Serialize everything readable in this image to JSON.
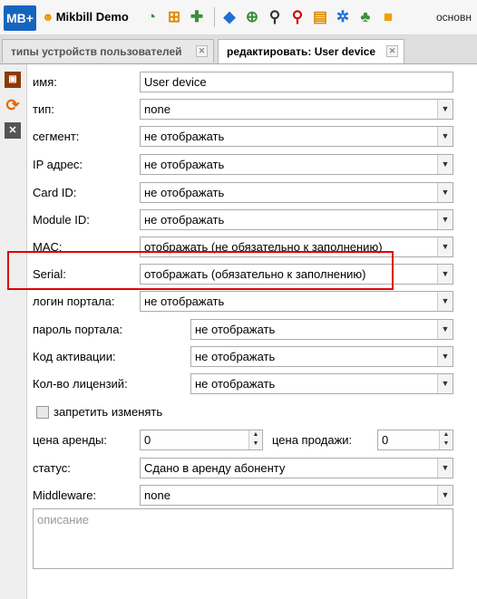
{
  "app": {
    "logo": "MB+",
    "name": "Mikbill Demo",
    "right_text": "основн"
  },
  "toolbar_icons": [
    {
      "name": "dashboard-icon",
      "glyph": "◔",
      "color": "#3a8f3a"
    },
    {
      "name": "calendar-add-icon",
      "glyph": "⊞",
      "color": "#e08a00"
    },
    {
      "name": "add-user-icon",
      "glyph": "✚",
      "color": "#3a8f3a"
    },
    {
      "name": "tags-icon",
      "glyph": "◆",
      "color": "#1e6fd0"
    },
    {
      "name": "globe-icon",
      "glyph": "⊕",
      "color": "#3a8f3a"
    },
    {
      "name": "search-icon",
      "glyph": "⚲",
      "color": "#333333"
    },
    {
      "name": "search-red-icon",
      "glyph": "⚲",
      "color": "#d00000"
    },
    {
      "name": "clipboard-icon",
      "glyph": "▤",
      "color": "#e08a00"
    },
    {
      "name": "gears-icon",
      "glyph": "✲",
      "color": "#1e6fd0"
    },
    {
      "name": "network-icon",
      "glyph": "♣",
      "color": "#3a8f3a"
    },
    {
      "name": "note-icon",
      "glyph": "■",
      "color": "#f0a000"
    }
  ],
  "tabs": [
    {
      "label": "типы устройств пользователей"
    },
    {
      "label": "редактировать: User device"
    }
  ],
  "form": {
    "name_label": "имя:",
    "name_value": "User device",
    "type_label": "тип:",
    "type_value": "none",
    "segment_label": "сегмент:",
    "segment_value": "не отображать",
    "ip_label": "IP адрес:",
    "ip_value": "не отображать",
    "cardid_label": "Card ID:",
    "cardid_value": "не отображать",
    "moduleid_label": "Module ID:",
    "moduleid_value": "не отображать",
    "mac_label": "MAC:",
    "mac_value": "отображать (не обязательно к заполнению)",
    "serial_label": "Serial:",
    "serial_value": "отображать (обязательно к заполнению)",
    "login_label": "логин портала:",
    "login_value": "не отображать",
    "password_label": "пароль портала:",
    "password_value": "не отображать",
    "activation_label": "Код активации:",
    "activation_value": "не отображать",
    "licenses_label": "Кол-во лицензий:",
    "licenses_value": "не отображать",
    "lock_label": "запретить изменять",
    "rent_label": "цена аренды:",
    "rent_value": "0",
    "sale_label": "цена продажи:",
    "sale_value": "0",
    "status_label": "статус:",
    "status_value": "Сдано в аренду абоненту",
    "middleware_label": "Middleware:",
    "middleware_value": "none",
    "description_placeholder": "описание"
  }
}
